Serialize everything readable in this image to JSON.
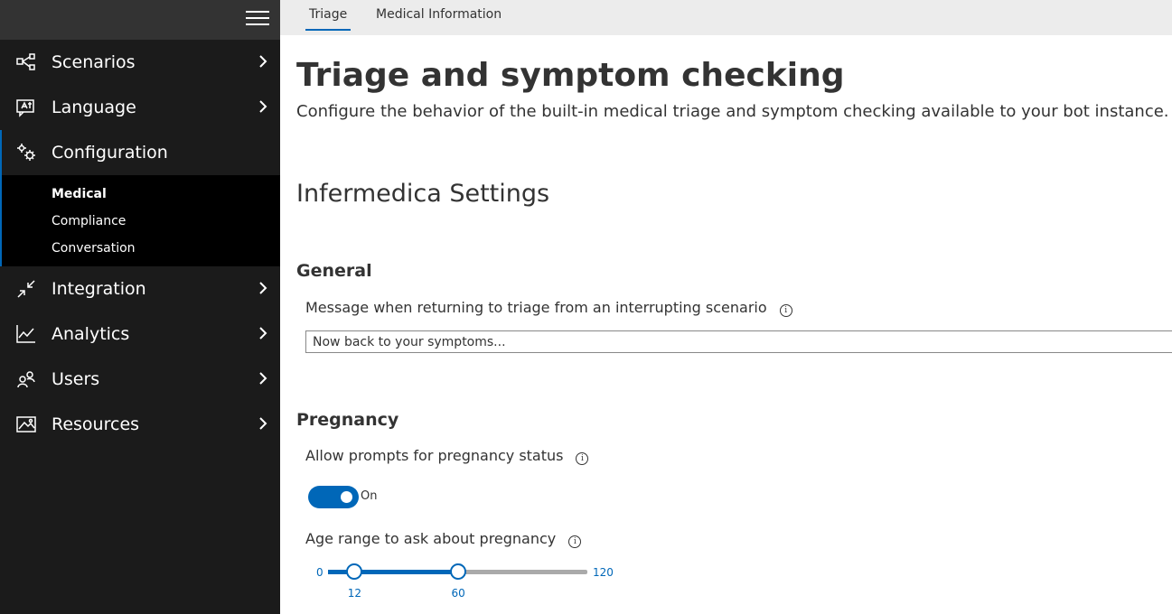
{
  "sidebar": {
    "items": [
      {
        "label": "Scenarios",
        "icon": "scenarios-icon"
      },
      {
        "label": "Language",
        "icon": "language-icon"
      },
      {
        "label": "Configuration",
        "icon": "gears-icon"
      },
      {
        "label": "Integration",
        "icon": "integration-icon"
      },
      {
        "label": "Analytics",
        "icon": "analytics-icon"
      },
      {
        "label": "Users",
        "icon": "users-icon"
      },
      {
        "label": "Resources",
        "icon": "resources-icon"
      }
    ],
    "sub_items": [
      "Medical",
      "Compliance",
      "Conversation"
    ]
  },
  "tabs": [
    "Triage",
    "Medical Information"
  ],
  "main": {
    "title": "Triage and symptom checking",
    "description": "Configure the behavior of the built-in medical triage and symptom checking available to your bot instance.",
    "section_title": "Infermedica Settings",
    "general": {
      "heading": "General",
      "message_label": "Message when returning to triage from an interrupting scenario",
      "message_value": "Now back to your symptoms..."
    },
    "pregnancy": {
      "heading": "Pregnancy",
      "allow_label": "Allow prompts for pregnancy status",
      "toggle_state": "On",
      "age_label": "Age range to ask about pregnancy",
      "range_min": "0",
      "range_max": "120",
      "range_low": "12",
      "range_high": "60"
    }
  },
  "info_icon_glyph": "i",
  "colors": {
    "accent": "#0067b8",
    "sidebar_bg": "#1b1b1b",
    "tabbar_bg": "#ececec"
  }
}
